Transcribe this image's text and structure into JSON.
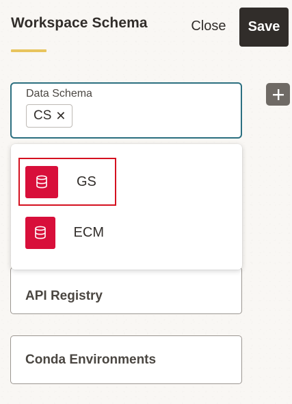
{
  "header": {
    "title": "Workspace Schema",
    "close_label": "Close",
    "save_label": "Save"
  },
  "schema_field": {
    "label": "Data Schema",
    "selected": [
      {
        "label": "CS",
        "remove_symbol": "✕"
      }
    ]
  },
  "dropdown": {
    "options": [
      {
        "label": "GS",
        "icon": "database-icon",
        "highlighted": true
      },
      {
        "label": "ECM",
        "icon": "database-icon",
        "highlighted": false
      }
    ]
  },
  "cards": [
    {
      "label": "API Registry"
    },
    {
      "label": "Conda Environments"
    }
  ],
  "colors": {
    "primary_dark": "#312d2a",
    "accent_underline": "#e8c45d",
    "focus_border": "#2b6f80",
    "db_icon_bg": "#d80f3a",
    "highlight_border": "#d4101f",
    "add_button_bg": "#6f6a65"
  }
}
